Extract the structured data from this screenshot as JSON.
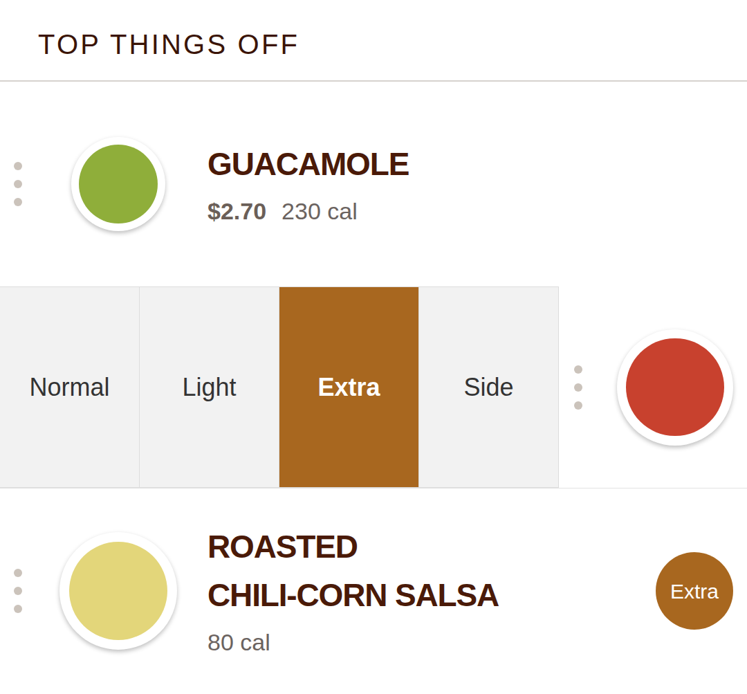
{
  "header": {
    "title": "TOP THINGS OFF"
  },
  "rows": [
    {
      "kind": "item",
      "name_lines": [
        "GUACAMOLE"
      ],
      "price": "$2.70",
      "calories": "230 cal",
      "badge": "",
      "color": "#8fae3a"
    },
    {
      "kind": "options",
      "options": [
        {
          "label": "Normal",
          "selected": false
        },
        {
          "label": "Light",
          "selected": false
        },
        {
          "label": "Extra",
          "selected": true
        },
        {
          "label": "Side",
          "selected": false
        }
      ],
      "color": "#c8412e"
    },
    {
      "kind": "item",
      "name_lines": [
        "ROASTED",
        "CHILI-CORN SALSA"
      ],
      "price": "",
      "calories": "80 cal",
      "badge": "Extra",
      "color": "#e3d67a"
    }
  ]
}
